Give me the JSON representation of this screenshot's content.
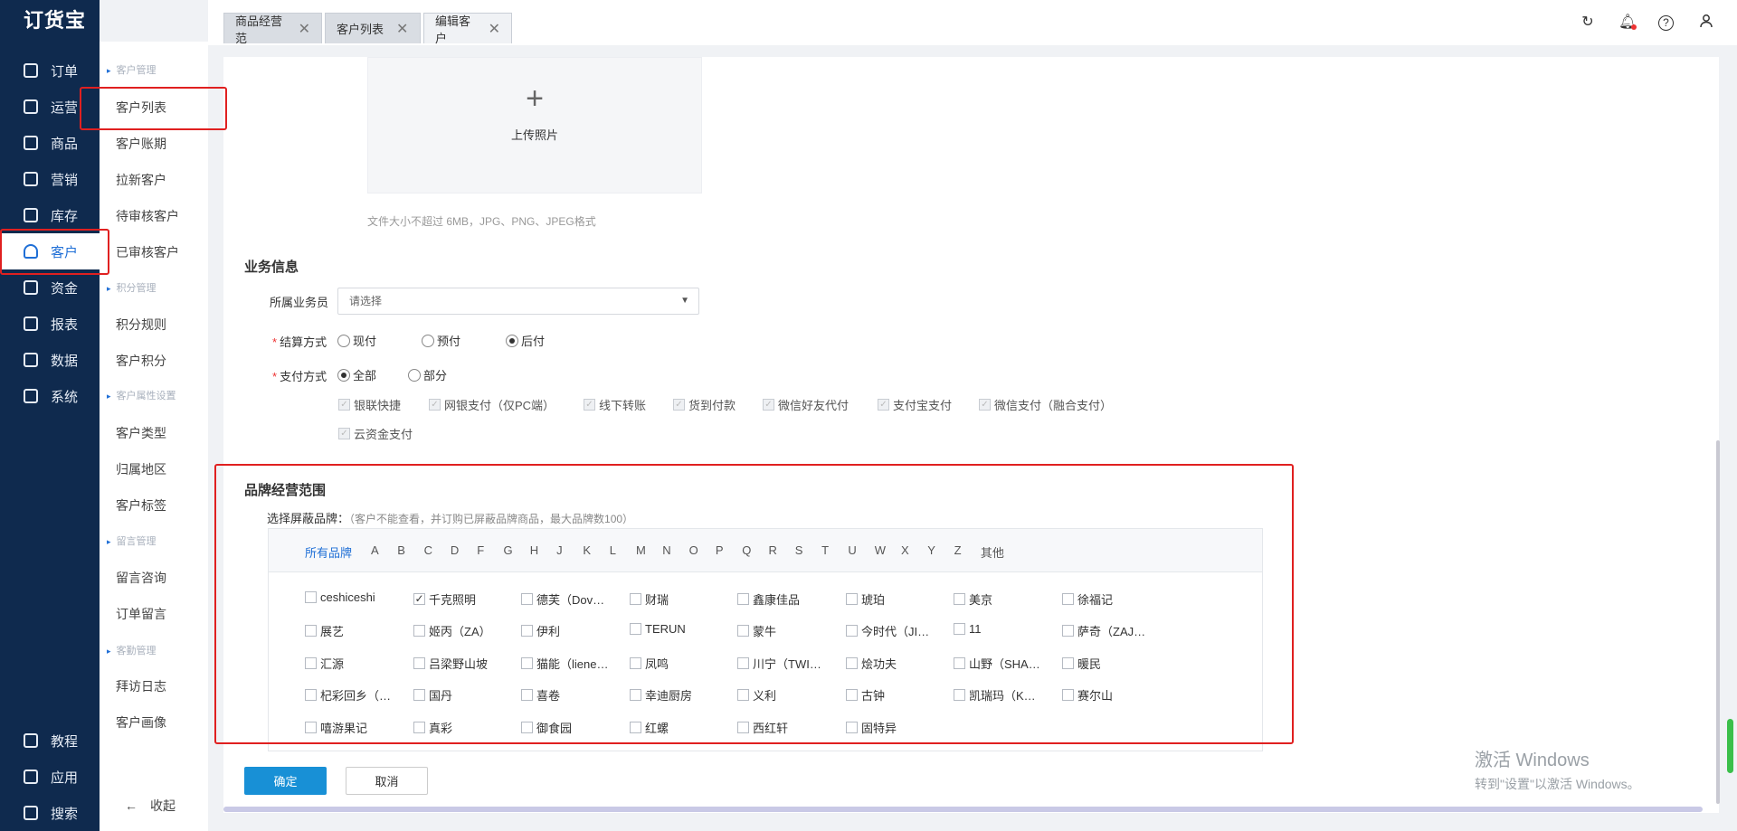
{
  "app": {
    "logo": "订货宝"
  },
  "nav": {
    "items": [
      {
        "label": "订单",
        "icon": "order-icon"
      },
      {
        "label": "运营",
        "icon": "operation-icon"
      },
      {
        "label": "商品",
        "icon": "goods-icon"
      },
      {
        "label": "营销",
        "icon": "marketing-icon"
      },
      {
        "label": "库存",
        "icon": "warehouse-icon"
      },
      {
        "label": "客户",
        "icon": "user-icon",
        "active": true
      },
      {
        "label": "资金",
        "icon": "money-bag-icon"
      },
      {
        "label": "报表",
        "icon": "pie-chart-icon"
      },
      {
        "label": "数据",
        "icon": "data-icon"
      },
      {
        "label": "系统",
        "icon": "monitor-icon"
      }
    ],
    "bottom": [
      {
        "label": "教程",
        "icon": "play-icon"
      },
      {
        "label": "应用",
        "icon": "app-cube-icon"
      },
      {
        "label": "搜索",
        "icon": "search-icon"
      }
    ]
  },
  "subnav": {
    "groups": [
      "客户管理",
      "积分管理",
      "客户属性设置",
      "留言管理",
      "客勤管理"
    ],
    "items": [
      "客户列表",
      "客户账期",
      "拉新客户",
      "待审核客户",
      "已审核客户",
      "积分规则",
      "客户积分",
      "客户类型",
      "归属地区",
      "客户标签",
      "留言咨询",
      "订单留言",
      "拜访日志",
      "客户画像"
    ],
    "collapse": "收起"
  },
  "tabs": [
    {
      "label": "商品经营范",
      "active": false
    },
    {
      "label": "客户列表",
      "active": false
    },
    {
      "label": "编辑客户",
      "active": true
    }
  ],
  "topbar_icons": [
    "refresh-icon",
    "bell-icon",
    "help-icon",
    "user-icon"
  ],
  "upload": {
    "plus": "+",
    "label": "上传照片",
    "hint": "文件大小不超过 6MB，JPG、PNG、JPEG格式"
  },
  "business": {
    "title": "业务信息",
    "salesman_label": "所属业务员",
    "salesman_value": "请选择",
    "settle_label": "结算方式",
    "settle_options": [
      "现付",
      "预付",
      "后付"
    ],
    "settle_selected": "后付",
    "pay_label": "支付方式",
    "pay_scope_options": [
      "全部",
      "部分"
    ],
    "pay_scope_selected": "全部",
    "pay_methods": [
      "银联快捷",
      "网银支付（仅PC端）",
      "线下转账",
      "货到付款",
      "微信好友代付",
      "支付宝支付",
      "微信支付（融合支付）",
      "云资金支付"
    ]
  },
  "brand_scope": {
    "title": "品牌经营范围",
    "note_label": "选择屏蔽品牌：",
    "note_hint": "（客户不能查看，并订购已屏蔽品牌商品，最大品牌数100）",
    "letters": [
      "所有品牌",
      "A",
      "B",
      "C",
      "D",
      "F",
      "G",
      "H",
      "J",
      "K",
      "L",
      "M",
      "N",
      "O",
      "P",
      "Q",
      "R",
      "S",
      "T",
      "U",
      "W",
      "X",
      "Y",
      "Z",
      "其他"
    ],
    "active_letter": "所有品牌",
    "brands": [
      [
        "ceshiceshi",
        "千克照明",
        "德芙（Dov…",
        "财瑞",
        "鑫康佳品",
        "琥珀",
        "美京",
        "徐福记"
      ],
      [
        "展艺",
        "姬丙（ZA）",
        "伊利",
        "TERUN",
        "蒙牛",
        "今时代（JI…",
        "11",
        "萨奇（ZAJ…"
      ],
      [
        "汇源",
        "吕梁野山坡",
        "猫能（liene…",
        "凤鸣",
        "川宁（TWI…",
        "烩功夫",
        "山野（SHA…",
        "暖民"
      ],
      [
        "杞彩回乡（…",
        "国丹",
        "喜卷",
        "幸迪厨房",
        "义利",
        "古钟",
        "凯瑞玛（K…",
        "赛尔山"
      ],
      [
        "嘻游果记",
        "真彩",
        "御食园",
        "红螺",
        "西红轩",
        "固特异"
      ]
    ],
    "checked": [
      "千克照明"
    ]
  },
  "actions": {
    "ok": "确定",
    "cancel": "取消"
  },
  "watermark": {
    "line1": "激活 Windows",
    "line2": "转到\"设置\"以激活 Windows。"
  },
  "colors": {
    "nav_bg": "#0f2a4e",
    "accent": "#1f6fd6",
    "primary_button": "#1890d6",
    "highlight_box": "#e02020"
  }
}
